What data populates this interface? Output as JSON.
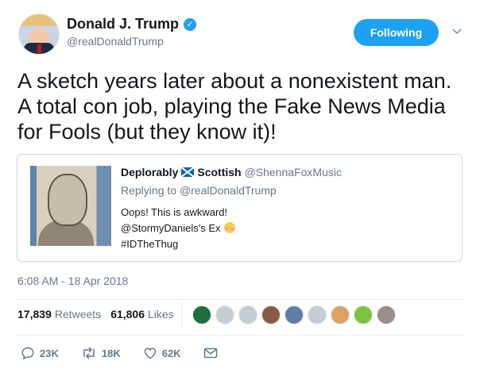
{
  "author": {
    "display_name": "Donald J. Trump",
    "handle": "@realDonaldTrump",
    "verified_icon": "check-icon",
    "follow_label": "Following"
  },
  "tweet": {
    "text": "A sketch years later about a nonexistent man. A total con job, playing the Fake News Media for Fools (but they know it)!",
    "timestamp": "6:08 AM - 18 Apr 2018"
  },
  "quoted": {
    "name_part1": "Deplorably",
    "name_part2": "Scottish",
    "handle": "@ShennaFoxMusic",
    "reply_prefix": "Replying to",
    "reply_to": "@realDonaldTrump",
    "line1": "Oops! This is awkward!",
    "line2": "@StormyDaniels's Ex",
    "line3": "#IDTheThug"
  },
  "stats": {
    "retweets_count": "17,839",
    "retweets_label": "Retweets",
    "likes_count": "61,806",
    "likes_label": "Likes",
    "liker_colors": [
      "#1f6f3a",
      "#c5cdd4",
      "#c5cdd4",
      "#8a5a44",
      "#5d7fa8",
      "#c5cdd4",
      "#e0a060",
      "#7cc242",
      "#9a8f86"
    ]
  },
  "actions": {
    "reply_count": "23K",
    "retweet_count": "18K",
    "like_count": "62K"
  },
  "colors": {
    "accent": "#1da1f2",
    "secondary_text": "#657786",
    "primary_text": "#14171a"
  }
}
